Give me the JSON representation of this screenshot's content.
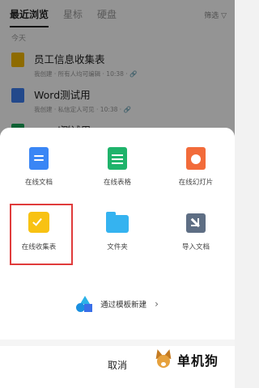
{
  "tabs": [
    {
      "label": "最近浏览"
    },
    {
      "label": "星标"
    },
    {
      "label": "硬盘"
    }
  ],
  "sort_label": "筛选 ▽",
  "section_label": "今天",
  "files": [
    {
      "title": "员工信息收集表",
      "meta": "我创建 · 所有人均可编辑 · 10:38 · 🔗",
      "color": "#f5b800"
    },
    {
      "title": "Word测试用",
      "meta": "我创建 · 私信定人可见 · 10:38 · 🔗",
      "color": "#3d7ff0"
    },
    {
      "title": "excel测试用",
      "meta": "",
      "color": "#1aa85b"
    }
  ],
  "create_items": [
    {
      "label": "在线文档",
      "icon": "doc-icon"
    },
    {
      "label": "在线表格",
      "icon": "sheet-icon"
    },
    {
      "label": "在线幻灯片",
      "icon": "slide-icon"
    },
    {
      "label": "在线收集表",
      "icon": "form-icon"
    },
    {
      "label": "文件夹",
      "icon": "folder-icon"
    },
    {
      "label": "导入文档",
      "icon": "import-icon"
    }
  ],
  "template_label": "通过模板新建",
  "template_chevron": "›",
  "cancel_label": "取消",
  "brand_text": "单机狗",
  "colors": {
    "highlight": "#e03b3b",
    "doc": "#3a86f5",
    "sheet": "#1fb36b",
    "slide": "#f26b3a",
    "form": "#f8c213",
    "folder": "#35b3f0",
    "import": "#5e6e84"
  }
}
